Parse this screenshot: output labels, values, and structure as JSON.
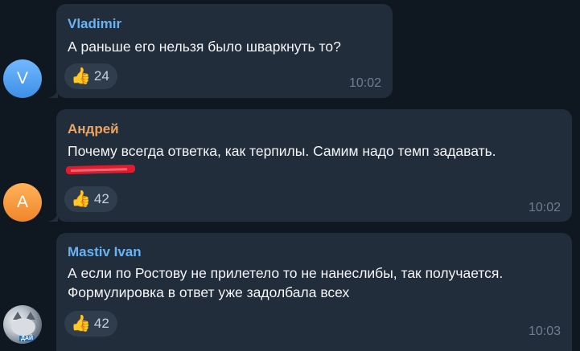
{
  "messages": [
    {
      "sender": "Vladimir",
      "avatar_letter": "V",
      "text": "А раньше его нельзя было шваркнуть то?",
      "reaction": {
        "emoji": "👍",
        "count": "24"
      },
      "time": "10:02"
    },
    {
      "sender": "Андрей",
      "avatar_letter": "А",
      "text": "Почему всегда ответка, как терпилы. Самим надо темп задавать.",
      "reaction": {
        "emoji": "👍",
        "count": "42"
      },
      "time": "10:02"
    },
    {
      "sender": "Mastiv Ivan",
      "avatar_letter": "",
      "avatar_tag": "ДАЙ",
      "text": "А если по Ростову не прилетело то не нанеслибы, так получается. Формулировка в ответ уже задолбала всех",
      "reaction": {
        "emoji": "👍",
        "count": "42"
      },
      "time": "10:03"
    }
  ],
  "colors": {
    "background": "#0f1720",
    "bubble": "#212d3b",
    "name_blue": "#6ab2f2",
    "name_orange": "#f0a35a",
    "redaction": "#e01b2e"
  }
}
